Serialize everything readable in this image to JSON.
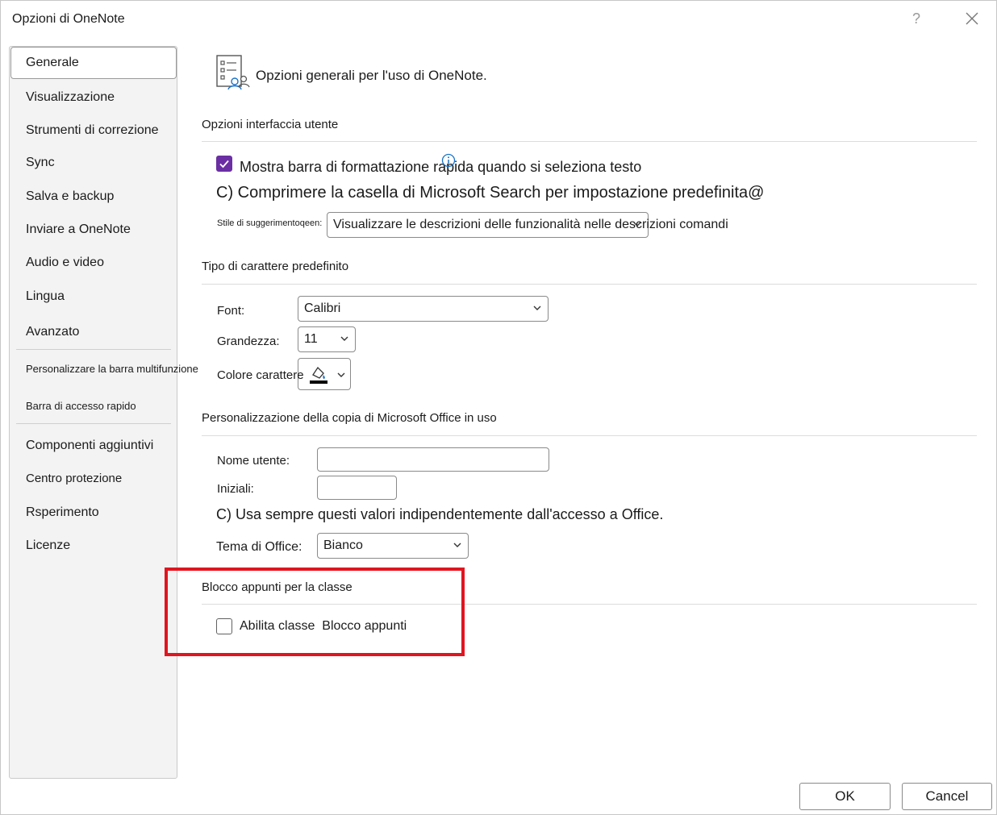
{
  "window": {
    "title": "Opzioni di OneNote",
    "help_label": "?"
  },
  "sidebar": {
    "items": [
      {
        "label": "Generale",
        "active": true
      },
      {
        "label": "Visualizzazione"
      },
      {
        "label": "Strumenti di correzione"
      },
      {
        "label": "Sync"
      },
      {
        "label": "Salva e backup"
      },
      {
        "label": "Inviare a OneNote"
      },
      {
        "label": "Audio e video"
      },
      {
        "label": "Lingua"
      },
      {
        "label": "Avanzato"
      },
      {
        "label": "Personalizzare la barra multifunzione"
      },
      {
        "label": "Barra di accesso rapido"
      },
      {
        "label": "Componenti aggiuntivi"
      },
      {
        "label": "Centro protezione"
      },
      {
        "label": "Rsperimento"
      },
      {
        "label": "Licenze"
      }
    ]
  },
  "main": {
    "header": "Opzioni generali per l'uso di OneNote.",
    "ui_section": {
      "title": "Opzioni interfaccia utente",
      "mini_toolbar_label": "Mostra barra di formattazione rapida quando si seleziona testo",
      "mini_toolbar_checked": true,
      "search_collapse_label": "C) Comprimere la casella di Microsoft Search per impostazione predefinita@",
      "screentip_label": "Stile di suggerimentoqeen:",
      "screentip_value": "Visualizzare le descrizioni delle funzionalità nelle descrizioni comandi"
    },
    "font_section": {
      "title": "Tipo di carattere predefinito",
      "font_label": "Font:",
      "font_value": "Calibri",
      "size_label": "Grandezza:",
      "size_value": "11",
      "color_label": "Colore carattere"
    },
    "personalize_section": {
      "title": "Personalizzazione della copia di Microsoft Office in uso",
      "username_label": "Nome utente:",
      "username_value": "",
      "initials_label": "Iniziali:",
      "initials_value": "",
      "always_use_label": "C) Usa sempre questi valori indipendentemente dall'accesso a Office.",
      "theme_label": "Tema di Office:",
      "theme_value": "Bianco"
    },
    "class_section": {
      "title": "Blocco appunti per la classe",
      "enable_label_1": "Abilita classe",
      "enable_label_2": "Blocco appunti",
      "enable_checked": false
    }
  },
  "footer": {
    "ok_label": "OK",
    "cancel_label": "Cancel"
  },
  "colors": {
    "accent": "#6b2fa3",
    "highlight": "#e0151f",
    "info": "#1a73c9"
  },
  "icons": [
    "help-icon",
    "close-icon",
    "options-general-icon",
    "checkmark-icon",
    "info-icon",
    "chevron-down-icon",
    "font-color-icon"
  ]
}
